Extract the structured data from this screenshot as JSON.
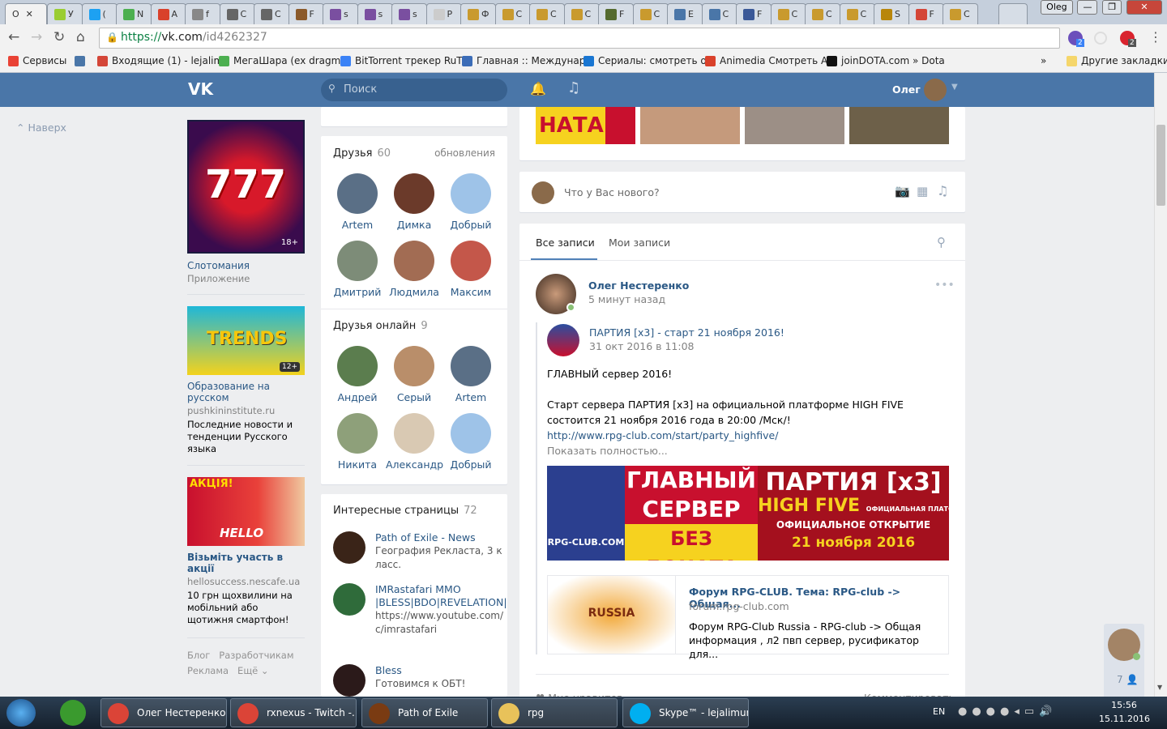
{
  "browser": {
    "tabs": [
      {
        "label": "О",
        "color": "#4a76a8",
        "active": true
      },
      {
        "label": "У",
        "color": "#9acd32"
      },
      {
        "label": "(",
        "color": "#1da1f2"
      },
      {
        "label": "N",
        "color": "#4caf50"
      },
      {
        "label": "А",
        "color": "#d9412b"
      },
      {
        "label": "f",
        "color": "#888"
      },
      {
        "label": "С",
        "color": "#666"
      },
      {
        "label": "С",
        "color": "#666"
      },
      {
        "label": "F",
        "color": "#8b5a2b"
      },
      {
        "label": "s",
        "color": "#7a4fa0"
      },
      {
        "label": "s",
        "color": "#7a4fa0"
      },
      {
        "label": "s",
        "color": "#7a4fa0"
      },
      {
        "label": "P",
        "color": "#ccc"
      },
      {
        "label": "Ф",
        "color": "#c99a2e"
      },
      {
        "label": "С",
        "color": "#c99a2e"
      },
      {
        "label": "С",
        "color": "#c99a2e"
      },
      {
        "label": "С",
        "color": "#c99a2e"
      },
      {
        "label": "F",
        "color": "#556b2f"
      },
      {
        "label": "С",
        "color": "#c99a2e"
      },
      {
        "label": "Е",
        "color": "#4a76a8"
      },
      {
        "label": "С",
        "color": "#4a76a8"
      },
      {
        "label": "F",
        "color": "#3b5998"
      },
      {
        "label": "С",
        "color": "#c99a2e"
      },
      {
        "label": "С",
        "color": "#c99a2e"
      },
      {
        "label": "С",
        "color": "#c99a2e"
      },
      {
        "label": "S",
        "color": "#b8860b"
      },
      {
        "label": "F",
        "color": "#d44638"
      },
      {
        "label": "С",
        "color": "#c99a2e"
      }
    ],
    "profile_button": "Oleg",
    "url_scheme": "https://",
    "url_host": "vk.com",
    "url_path": "/id4262327",
    "extension_badges": [
      "2",
      "2"
    ],
    "bookmarks": [
      "Сервисы",
      "",
      "Входящие (1) - lejalim",
      "МегаШара (ex dragm",
      "BitTorrent трекер RuT",
      "Главная :: Междунар",
      "Сериалы: смотреть о",
      "Animedia Смотреть А",
      "joinDOTA.com » Dota"
    ],
    "bookmarks_more": "»",
    "other_bookmarks": "Другие закладки"
  },
  "vk": {
    "accent": "#4a76a8",
    "search_placeholder": "Поиск",
    "user_name": "Олег",
    "back_to_top": "Наверх",
    "ads": [
      {
        "title": "Слотомания",
        "sub": "Приложение",
        "age": "18+"
      },
      {
        "title": "Образование на русском",
        "sub": "pushkininstitute.ru",
        "desc": "Последние новости и тенденции Русского языка",
        "age": "12+",
        "banner": "TRENDS"
      },
      {
        "title": "Візьміть участь в акції",
        "sub": "hellosuccess.nescafe.ua",
        "desc": "10 грн щохвилини на мобільний або щотижня смартфон!",
        "banner": "АКЦІЯ!"
      }
    ],
    "footer_links": [
      "Блог",
      "Разработчикам",
      "Реклама",
      "Ещё"
    ],
    "friends": {
      "title": "Друзья",
      "count": "60",
      "updates": "обновления",
      "items": [
        "Artem",
        "Димка",
        "Добрый",
        "Дмитрий",
        "Людмила",
        "Максим"
      ]
    },
    "friends_online": {
      "title": "Друзья онлайн",
      "count": "9",
      "items": [
        "Андрей",
        "Серый",
        "Artem",
        "Никита",
        "Александр",
        "Добрый"
      ]
    },
    "pages": {
      "title": "Интересные страницы",
      "count": "72",
      "items": [
        {
          "name": "Path of Exile - News",
          "desc": "География Рекласта, 3 класс."
        },
        {
          "name": "IMRastafari MMO |BLESS|BDO|REVELATION|",
          "desc": "https://www.youtube.com/c/imrastafari"
        },
        {
          "name": "Bless",
          "desc": "Готовимся к ОБТ!"
        }
      ]
    },
    "composer_placeholder": "Что у Вас нового?",
    "wall_tabs": [
      "Все записи",
      "Мои записи"
    ],
    "post": {
      "author": "Олег Нестеренко",
      "time": "5 минут назад",
      "repost_title": "ПАРТИЯ [x3] - старт 21 ноября 2016!",
      "repost_time": "31 окт 2016 в 11:08",
      "text1": "ГЛАВНЫЙ сервер 2016!",
      "text2": "Старт сервера ПАРТИЯ [x3] на официальной платформе HIGH FIVE",
      "text3": "состоится 21 ноября 2016 года в 20:00 /Мск/!",
      "link": "http://www.rpg-club.com/start/party_highfive/",
      "show_more": "Показать полностью...",
      "banner": {
        "left1": "ГЛАВНЫЙ",
        "left2": "СЕРВЕР",
        "left3": "БЕЗ ДОНАТА",
        "logo": "RPG-CLUB.COM",
        "right1": "ПАРТИЯ [x3]",
        "right2": "HIGH FIVE",
        "right2b": "ОФИЦИАЛЬНАЯ ПЛАТФОРМА",
        "right3": "ОФИЦИАЛЬНОЕ ОТКРЫТИЕ",
        "right4": "21 ноября 2016"
      },
      "snippet": {
        "title": "Форум RPG-CLUB. Тема: RPG-club -> Общая...",
        "domain": "forum.rpg-club.com",
        "desc": "Форум RPG-Club Russia - RPG-club -> Общая информация , л2 пвп сервер, русификатор для...",
        "image_text": "RUSSIA"
      },
      "likes": "Мне нравится",
      "comment": "Комментировать"
    },
    "photo_strip_text": "НАТА",
    "chat_count": "7"
  },
  "taskbar": {
    "items": [
      "Олег Нестеренко...",
      "rxnexus - Twitch -...",
      "Path of Exile",
      "rpg",
      "Skype™ - lejalimur"
    ],
    "lang": "EN",
    "time": "15:56",
    "date": "15.11.2016"
  }
}
